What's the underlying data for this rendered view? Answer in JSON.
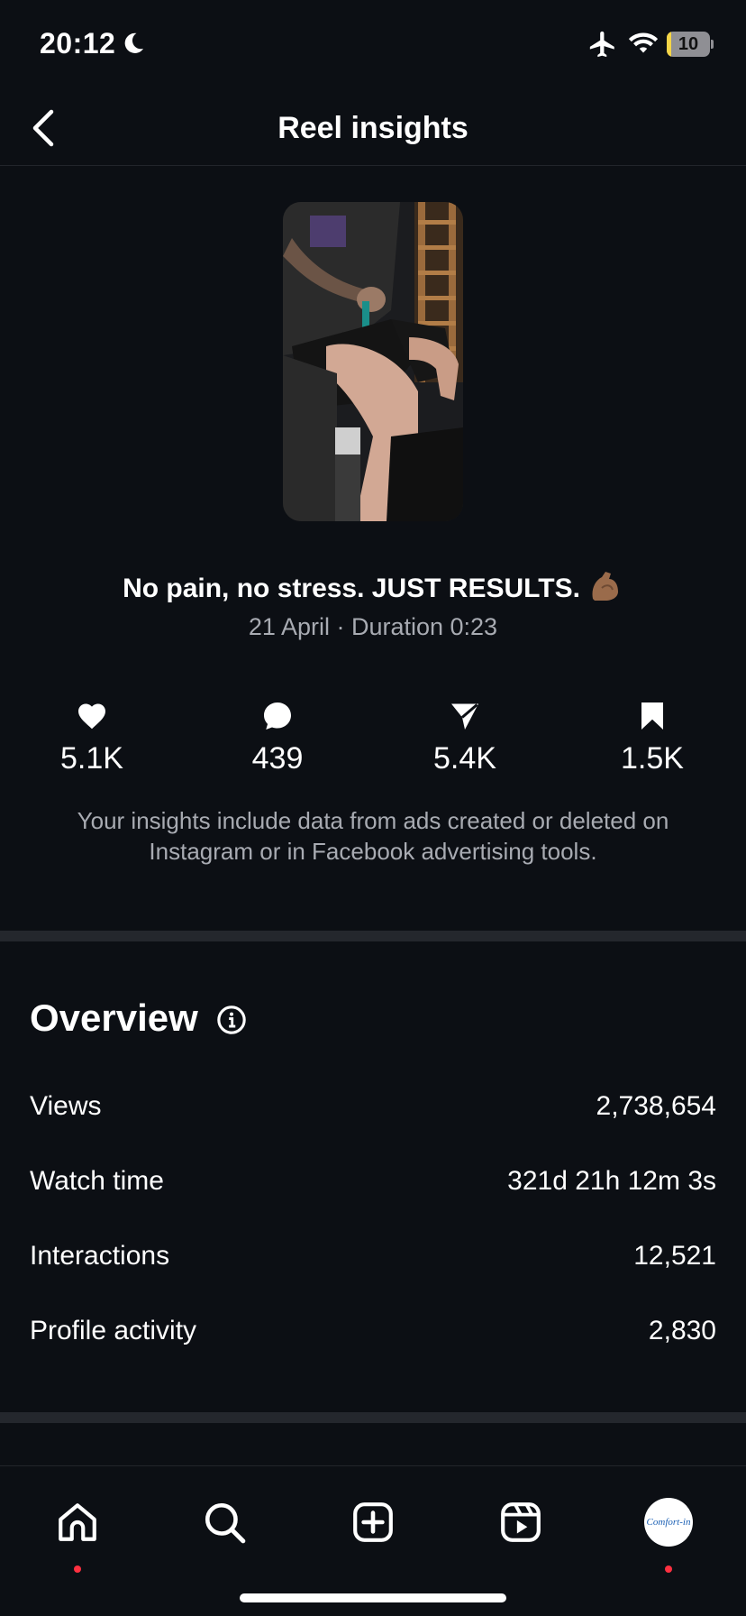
{
  "status_bar": {
    "time": "20:12",
    "battery_level": "10",
    "battery_fraction": 0.1,
    "icons": [
      "moon-icon",
      "airplane-icon",
      "wifi-icon",
      "battery-icon"
    ]
  },
  "header": {
    "title": "Reel insights",
    "back_icon": "chevron-left-icon"
  },
  "reel": {
    "caption": "No pain, no stress. JUST RESULTS.",
    "caption_emoji": "flexed-biceps-emoji",
    "meta": "21 April · Duration 0:23"
  },
  "stats": [
    {
      "icon": "heart-icon",
      "value": "5.1K"
    },
    {
      "icon": "comment-icon",
      "value": "439"
    },
    {
      "icon": "share-icon",
      "value": "5.4K"
    },
    {
      "icon": "bookmark-icon",
      "value": "1.5K"
    }
  ],
  "disclaimer": "Your insights include data from ads created or deleted on Instagram or in Facebook advertising tools.",
  "overview": {
    "title": "Overview",
    "info_icon": "info-icon",
    "metrics": [
      {
        "label": "Views",
        "value": "2,738,654"
      },
      {
        "label": "Watch time",
        "value": "321d 21h 12m 3s"
      },
      {
        "label": "Interactions",
        "value": "12,521"
      },
      {
        "label": "Profile activity",
        "value": "2,830"
      }
    ]
  },
  "bottom_nav": {
    "items": [
      "home-icon",
      "search-icon",
      "create-icon",
      "reels-icon",
      "profile-avatar"
    ],
    "avatar_text": "Comfort-in"
  },
  "colors": {
    "background": "#0c0f14",
    "divider": "#24272d",
    "muted_text": "#a8abb2",
    "notification_dot": "#ff3040",
    "battery_low": "#f5d547"
  }
}
